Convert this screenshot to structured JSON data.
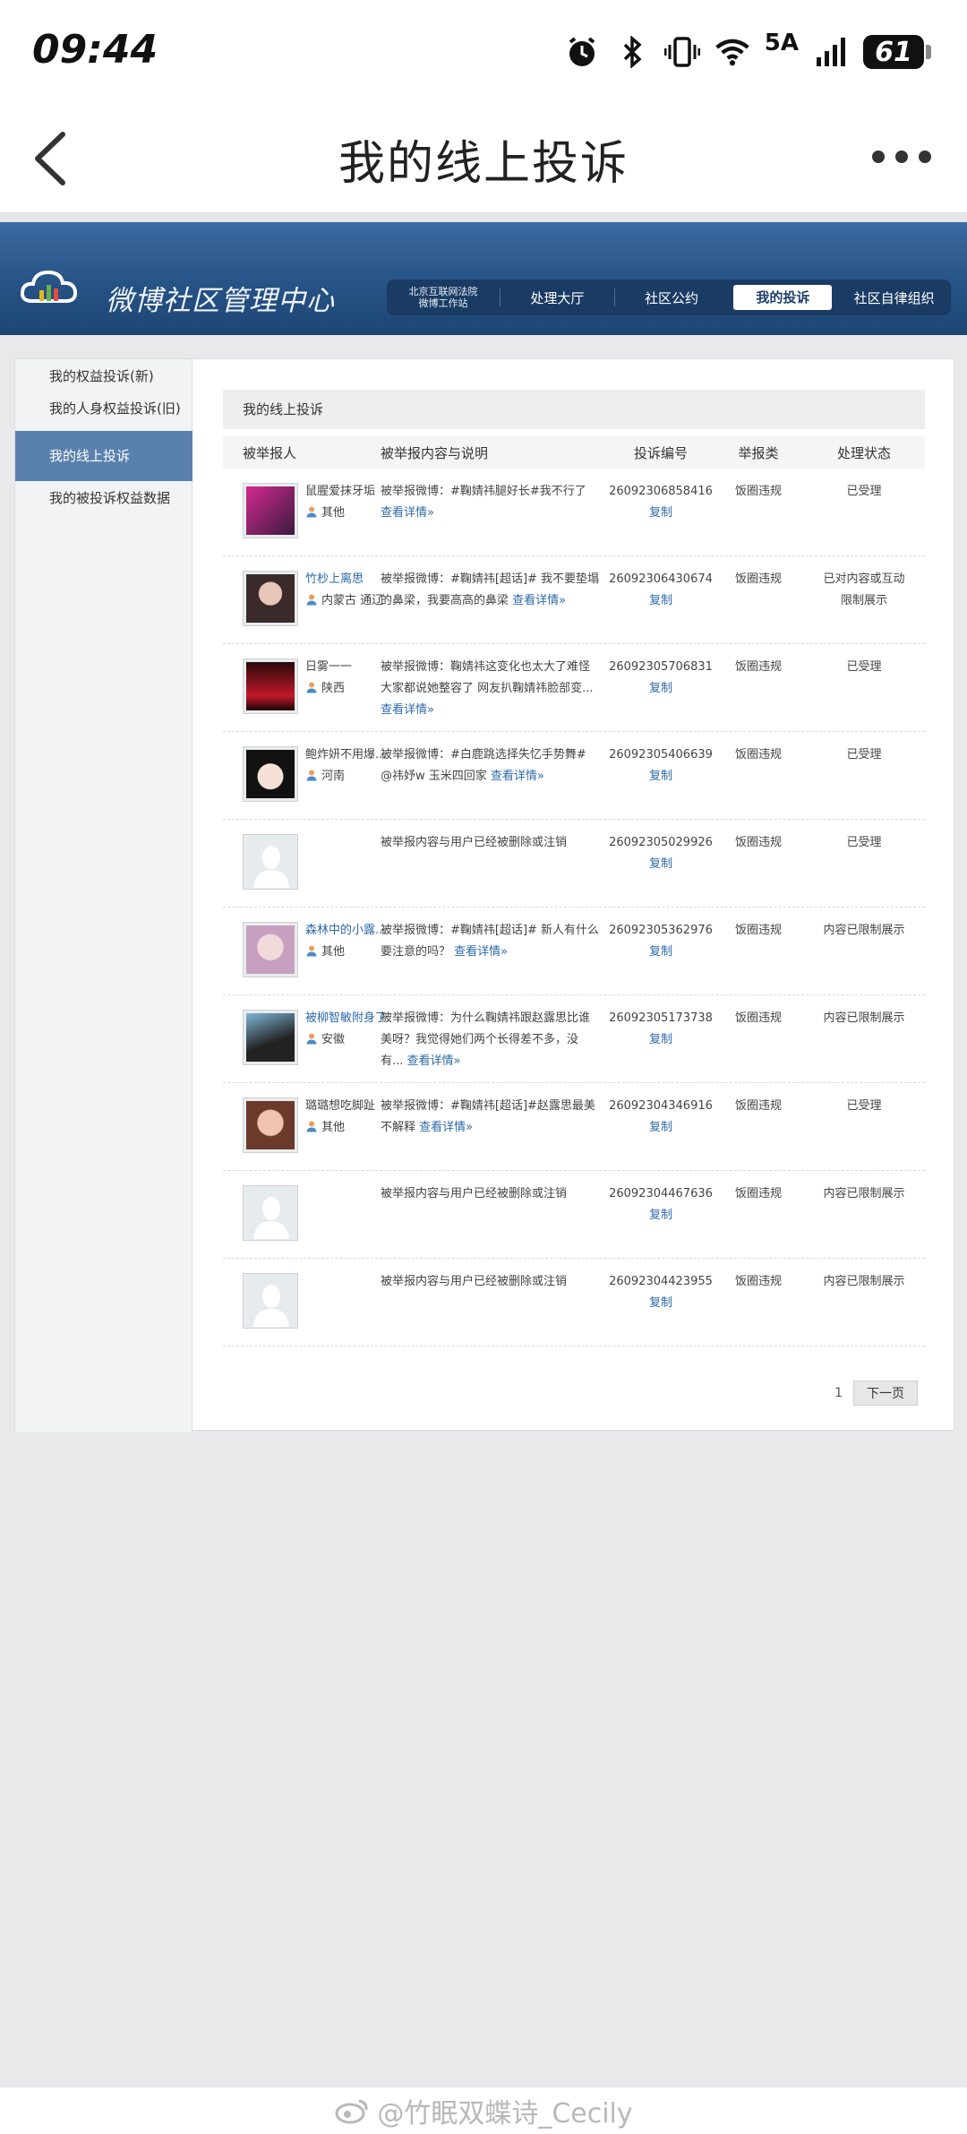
{
  "status_bar": {
    "time": "09:44",
    "network": "5A",
    "battery": "61",
    "icons": [
      "alarm-icon",
      "bluetooth-icon",
      "vibrate-icon",
      "wifi-icon",
      "signal-icon",
      "battery-icon"
    ]
  },
  "title_bar": {
    "title": "我的线上投诉"
  },
  "banner": {
    "site_name": "微博社区管理中心",
    "court_line1": "北京互联网法院",
    "court_line2": "微博工作站",
    "nav": [
      "处理大厅",
      "社区公约",
      "我的投诉",
      "社区自律组织"
    ],
    "active_nav": "我的投诉"
  },
  "sidebar": {
    "items": [
      "我的权益投诉(新)",
      "我的人身权益投诉(旧)",
      "我的线上投诉",
      "我的被投诉权益数据"
    ],
    "active": "我的线上投诉"
  },
  "content": {
    "heading": "我的线上投诉",
    "columns": [
      "被举报人",
      "被举报内容与说明",
      "投诉编号",
      "举报类",
      "处理状态"
    ],
    "more_label": "查看详情»",
    "copy_label": "复制",
    "rows": [
      {
        "user": "鼠腥爱抹牙垢",
        "location": "其他",
        "desc": "被举报微博：#鞠婧祎腿好长#我不行了",
        "more": "查看详情»",
        "number": "26092306858416",
        "type": "饭圈违规",
        "status": "已受理"
      },
      {
        "user": "竹杪上离思",
        "location": "内蒙古 通辽",
        "desc": "被举报微博：#鞠婧祎[超话]# 我不要垫塌的鼻梁，我要高高的鼻梁",
        "more": "查看详情»",
        "number": "26092306430674",
        "type": "饭圈违规",
        "status": "已对内容或互动限制展示"
      },
      {
        "user": "日雾一一",
        "location": "陕西",
        "desc": "被举报微博：鞠婧祎这变化也太大了难怪大家都说她整容了 网友扒鞠婧祎脸部变...",
        "more": "查看详情»",
        "number": "26092305706831",
        "type": "饭圈违规",
        "status": "已受理"
      },
      {
        "user": "鲍炸妍不用爆...",
        "location": "河南",
        "desc": "被举报微博：#白鹿跳选择失忆手势舞# @祎妤w 玉米四回家",
        "more": "查看详情»",
        "number": "26092305406639",
        "type": "饭圈违规",
        "status": "已受理"
      },
      {
        "user": "",
        "location": "",
        "desc": "被举报内容与用户已经被删除或注销",
        "more": "",
        "number": "26092305029926",
        "type": "饭圈违规",
        "status": "已受理"
      },
      {
        "user": "森林中的小露...",
        "location": "其他",
        "desc": "被举报微博：#鞠婧祎[超话]# 新人有什么要注意的吗？",
        "more": "查看详情»",
        "number": "26092305362976",
        "type": "饭圈违规",
        "status": "内容已限制展示"
      },
      {
        "user": "被柳智敏附身了",
        "location": "安徽",
        "desc": "被举报微博：为什么鞠婧祎跟赵露思比谁美呀？我觉得她们两个长得差不多，没有...",
        "more": "查看详情»",
        "number": "26092305173738",
        "type": "饭圈违规",
        "status": "内容已限制展示"
      },
      {
        "user": "璐璐想吃脚趾",
        "location": "其他",
        "desc": "被举报微博：#鞠婧祎[超话]#赵露思最美不解释",
        "more": "查看详情»",
        "number": "26092304346916",
        "type": "饭圈违规",
        "status": "已受理"
      },
      {
        "user": "",
        "location": "",
        "desc": "被举报内容与用户已经被删除或注销",
        "more": "",
        "number": "26092304467636",
        "type": "饭圈违规",
        "status": "内容已限制展示"
      },
      {
        "user": "",
        "location": "",
        "desc": "被举报内容与用户已经被删除或注销",
        "more": "",
        "number": "26092304423955",
        "type": "饭圈违规",
        "status": "内容已限制展示"
      }
    ]
  },
  "pager": {
    "page": "1",
    "next": "下一页"
  },
  "watermark": {
    "text": "@竹眠双蝶诗_Cecily"
  },
  "colors": {
    "banner": "#255184",
    "sidebar_active": "#5a81ad",
    "link": "#2d6aa8"
  }
}
